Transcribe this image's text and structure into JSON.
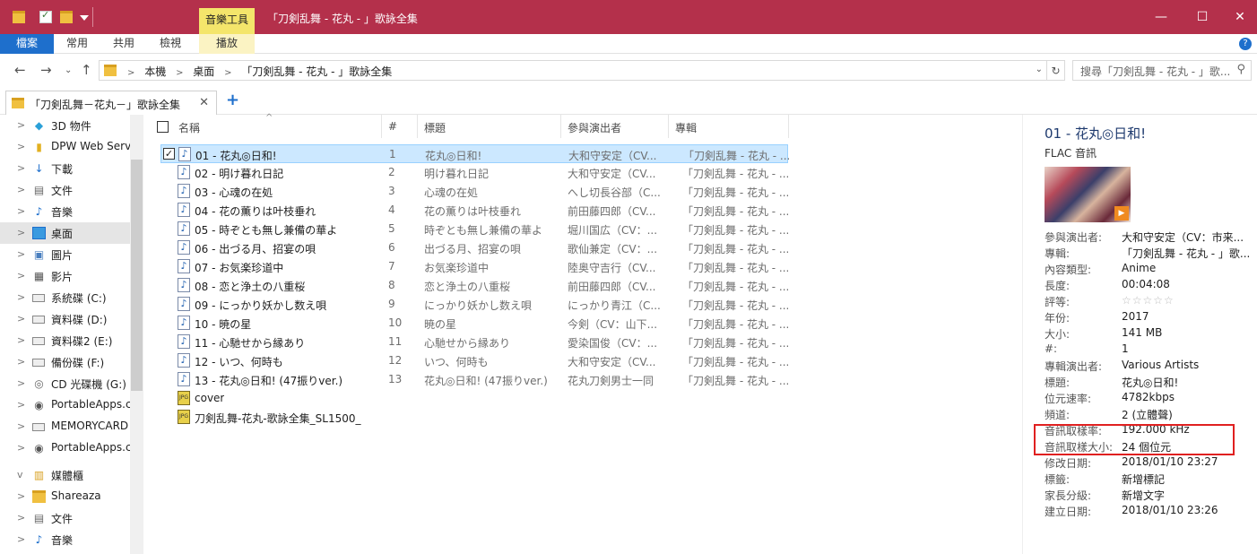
{
  "window": {
    "title": "「刀剣乱舞 - 花丸 - 」歌詠全集",
    "context_tab_group": "音樂工具",
    "controls": {
      "minimize": "—",
      "maximize": "☐",
      "close": "✕"
    }
  },
  "ribbon": {
    "tabs": [
      "檔案",
      "常用",
      "共用",
      "檢視",
      "播放"
    ],
    "help": "?"
  },
  "address": {
    "crumbs": [
      "本機",
      "桌面",
      "「刀剣乱舞 - 花丸 - 」歌詠全集"
    ],
    "separator": ">",
    "search_placeholder": "搜尋「刀剣乱舞 - 花丸 - 」歌..."
  },
  "tab": {
    "label": "「刀剣乱舞－花丸－」歌詠全集",
    "close": "✕",
    "add": "+"
  },
  "sidebar": {
    "items": [
      {
        "label": "3D 物件",
        "icon": "cube-3d-icon",
        "chev": ">"
      },
      {
        "label": "DPW Web Serv",
        "icon": "web-folder-icon",
        "chev": ">"
      },
      {
        "label": "下載",
        "icon": "download-icon",
        "chev": ">"
      },
      {
        "label": "文件",
        "icon": "document-icon",
        "chev": ">"
      },
      {
        "label": "音樂",
        "icon": "music-note-icon",
        "chev": ">"
      },
      {
        "label": "桌面",
        "icon": "desktop-icon",
        "chev": ">"
      },
      {
        "label": "圖片",
        "icon": "picture-icon",
        "chev": ">"
      },
      {
        "label": "影片",
        "icon": "film-icon",
        "chev": ">"
      },
      {
        "label": "系統碟 (C:)",
        "icon": "system-drive-icon",
        "chev": ">"
      },
      {
        "label": "資料碟 (D:)",
        "icon": "drive-icon",
        "chev": ">"
      },
      {
        "label": "資料碟2 (E:)",
        "icon": "drive-icon",
        "chev": ">"
      },
      {
        "label": "備份碟 (F:)",
        "icon": "drive-icon",
        "chev": ">"
      },
      {
        "label": "CD 光碟機 (G:)",
        "icon": "cd-drive-icon",
        "chev": ">"
      },
      {
        "label": "PortableApps.c",
        "icon": "portableapps-icon",
        "chev": ">"
      },
      {
        "label": "MEMORYCARD",
        "icon": "drive-icon",
        "chev": ">"
      },
      {
        "label": "PortableApps.c",
        "icon": "portableapps-icon",
        "chev": ">"
      },
      {
        "label": "媒體櫃",
        "icon": "library-icon",
        "chev": "v"
      },
      {
        "label": "Shareaza",
        "icon": "folder-icon",
        "chev": ">"
      },
      {
        "label": "文件",
        "icon": "document-icon",
        "chev": ">"
      },
      {
        "label": "音樂",
        "icon": "music-note-icon",
        "chev": ">"
      }
    ],
    "selected_index": 5
  },
  "columns": {
    "name": "名稱",
    "num": "#",
    "title": "標題",
    "artist": "參與演出者",
    "album": "專輯"
  },
  "files": [
    {
      "name": "01 - 花丸◎日和!",
      "num": "1",
      "title": "花丸◎日和!",
      "artist": "大和守安定（CV...",
      "album": "「刀剣乱舞 - 花丸 - ...",
      "type": "audio"
    },
    {
      "name": "02 - 明け暮れ日記",
      "num": "2",
      "title": "明け暮れ日記",
      "artist": "大和守安定（CV...",
      "album": "「刀剣乱舞 - 花丸 - ...",
      "type": "audio"
    },
    {
      "name": "03 - 心魂の在処",
      "num": "3",
      "title": "心魂の在処",
      "artist": "へし切長谷部（C...",
      "album": "「刀剣乱舞 - 花丸 - ...",
      "type": "audio"
    },
    {
      "name": "04 - 花の薫りは叶枝垂れ",
      "num": "4",
      "title": "花の薫りは叶枝垂れ",
      "artist": "前田藤四郎（CV...",
      "album": "「刀剣乱舞 - 花丸 - ...",
      "type": "audio"
    },
    {
      "name": "05 - 時ぞとも無し兼備の華よ",
      "num": "5",
      "title": "時ぞとも無し兼備の華よ",
      "artist": "堀川国広（CV：...",
      "album": "「刀剣乱舞 - 花丸 - ...",
      "type": "audio"
    },
    {
      "name": "06 - 出づる月、招宴の唄",
      "num": "6",
      "title": "出づる月、招宴の唄",
      "artist": "歌仙兼定（CV：...",
      "album": "「刀剣乱舞 - 花丸 - ...",
      "type": "audio"
    },
    {
      "name": "07 - お気楽珍道中",
      "num": "7",
      "title": "お気楽珍道中",
      "artist": "陸奥守吉行（CV...",
      "album": "「刀剣乱舞 - 花丸 - ...",
      "type": "audio"
    },
    {
      "name": "08 - 恋と浄土の八重桜",
      "num": "8",
      "title": "恋と浄土の八重桜",
      "artist": "前田藤四郎（CV...",
      "album": "「刀剣乱舞 - 花丸 - ...",
      "type": "audio"
    },
    {
      "name": "09 - にっかり妖かし数え唄",
      "num": "9",
      "title": "にっかり妖かし数え唄",
      "artist": "にっかり青江（C...",
      "album": "「刀剣乱舞 - 花丸 - ...",
      "type": "audio"
    },
    {
      "name": "10 - 暁の星",
      "num": "10",
      "title": "暁の星",
      "artist": "今剣（CV：山下...",
      "album": "「刀剣乱舞 - 花丸 - ...",
      "type": "audio"
    },
    {
      "name": "11 - 心馳せから縁あり",
      "num": "11",
      "title": "心馳せから縁あり",
      "artist": "愛染国俊（CV：...",
      "album": "「刀剣乱舞 - 花丸 - ...",
      "type": "audio"
    },
    {
      "name": "12 - いつ、何時も",
      "num": "12",
      "title": "いつ、何時も",
      "artist": "大和守安定（CV...",
      "album": "「刀剣乱舞 - 花丸 - ...",
      "type": "audio"
    },
    {
      "name": "13 - 花丸◎日和! (47振りver.)",
      "num": "13",
      "title": "花丸◎日和! (47振りver.)",
      "artist": "花丸刀剣男士一同",
      "album": "「刀剣乱舞 - 花丸 - ...",
      "type": "audio"
    },
    {
      "name": "cover",
      "num": "",
      "title": "",
      "artist": "",
      "album": "",
      "type": "jpg"
    },
    {
      "name": "刀剣乱舞-花丸-歌詠全集_SL1500_",
      "num": "",
      "title": "",
      "artist": "",
      "album": "",
      "type": "jpg"
    }
  ],
  "selected_file_index": 0,
  "details": {
    "title": "01 - 花丸◎日和!",
    "type": "FLAC 音訊",
    "props": [
      {
        "label": "參與演出者:",
        "value": "大和守安定（CV：市来..."
      },
      {
        "label": "專輯:",
        "value": "「刀剣乱舞 - 花丸 - 」歌..."
      },
      {
        "label": "內容類型:",
        "value": "Anime"
      },
      {
        "label": "長度:",
        "value": "00:04:08"
      },
      {
        "label": "評等:",
        "value": "☆☆☆☆☆"
      },
      {
        "label": "年份:",
        "value": "2017"
      },
      {
        "label": "大小:",
        "value": "141 MB"
      },
      {
        "label": "#:",
        "value": "1"
      },
      {
        "label": "專輯演出者:",
        "value": "Various Artists"
      },
      {
        "label": "標題:",
        "value": "花丸◎日和!"
      },
      {
        "label": "位元速率:",
        "value": "4782kbps"
      },
      {
        "label": "頻道:",
        "value": "2 (立體聲)"
      },
      {
        "label": "音訊取樣率:",
        "value": "192.000 kHz"
      },
      {
        "label": "音訊取樣大小:",
        "value": "24 個位元"
      },
      {
        "label": "修改日期:",
        "value": "2018/01/10 23:27"
      },
      {
        "label": "標籤:",
        "value": "新增標記"
      },
      {
        "label": "家長分級:",
        "value": "新增文字"
      },
      {
        "label": "建立日期:",
        "value": "2018/01/10 23:26"
      }
    ]
  },
  "colors": {
    "titlebar": "#b4304b",
    "file_tab": "#1e6fcc",
    "context_tab": "#f4e56b",
    "selection": "#cce8ff",
    "highlight_box": "#e02020"
  }
}
